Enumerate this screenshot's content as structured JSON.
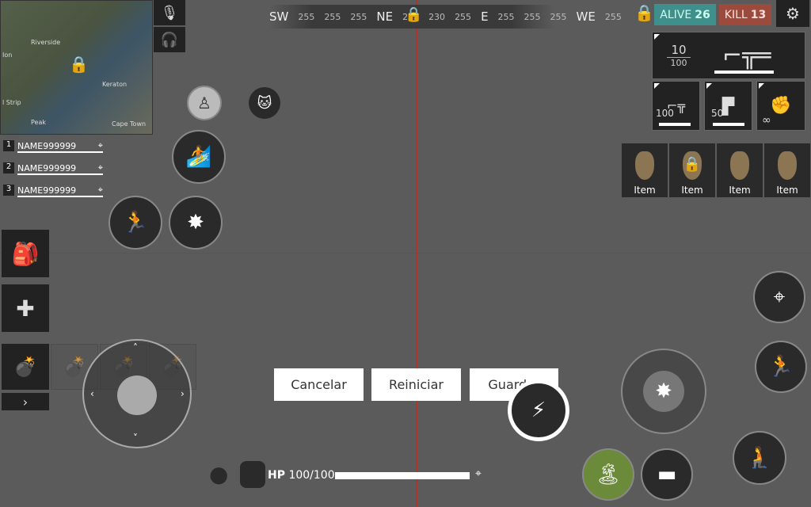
{
  "compass": {
    "marks": [
      "SW",
      "255",
      "255",
      "255",
      "NE",
      "235",
      "230",
      "255",
      "E",
      "255",
      "255",
      "255",
      "WE",
      "255",
      "255"
    ]
  },
  "minimap": {
    "labels": [
      "Riverside",
      "Ion",
      "Keraton",
      "l Strip",
      "Peak",
      "Cape Town"
    ]
  },
  "voice": {
    "mic": "mic-icon",
    "headset": "headset-icon"
  },
  "team": [
    {
      "num": "1",
      "name": "NAME999999"
    },
    {
      "num": "2",
      "name": "NAME999999"
    },
    {
      "num": "3",
      "name": "NAME999999"
    }
  ],
  "stats": {
    "alive_label": "ALIVE",
    "alive": "26",
    "kill_label": "KILL",
    "kill": "13",
    "alive_color": "#3f8f8c",
    "kill_color": "#9c4a3c"
  },
  "weapons": {
    "primary_ammo": "10",
    "primary_reserve": "100",
    "slot2": "100",
    "slot3": "50",
    "slot4": "∞"
  },
  "items": [
    "Item",
    "Item",
    "Item",
    "Item"
  ],
  "dialog": {
    "cancel": "Cancelar",
    "reset": "Reiniciar",
    "save": "Guardar"
  },
  "hp": {
    "label": "HP",
    "value": "100/100",
    "fraction": 1.0
  }
}
